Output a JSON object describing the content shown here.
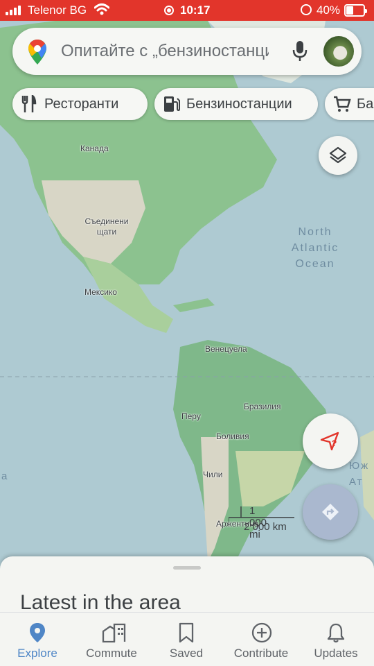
{
  "status_bar": {
    "carrier": "Telenor BG",
    "time": "10:17",
    "battery": "40%",
    "battery_level": 0.4
  },
  "search": {
    "placeholder": "Опитайте с „бензиностанции“"
  },
  "chips": [
    {
      "label": "Ресторанти",
      "icon": "restaurant-icon"
    },
    {
      "label": "Бензиностанции",
      "icon": "gas-station-icon"
    },
    {
      "label": "Ба",
      "icon": "shopping-cart-icon"
    }
  ],
  "map": {
    "labels": {
      "canada": "Канада",
      "usa": "Съединени щати",
      "mexico": "Мексико",
      "venezuela": "Венецуела",
      "brazil": "Бразилия",
      "peru": "Перу",
      "bolivia": "Боливия",
      "chile": "Чили",
      "argentina": "Аржентина"
    },
    "ocean": {
      "line1": "North",
      "line2": "Atlantic",
      "line3": "Ocean"
    },
    "edge": {
      "right1": "Юж",
      "right2": "Ат",
      "left": "a"
    },
    "scale": {
      "miles": "1 000 mi",
      "km": "2 000 km"
    }
  },
  "sheet": {
    "title": "Latest in the area"
  },
  "nav": [
    {
      "label": "Explore",
      "icon": "explore-pin-icon",
      "active": true
    },
    {
      "label": "Commute",
      "icon": "commute-icon",
      "active": false
    },
    {
      "label": "Saved",
      "icon": "bookmark-icon",
      "active": false
    },
    {
      "label": "Contribute",
      "icon": "add-circle-icon",
      "active": false
    },
    {
      "label": "Updates",
      "icon": "bell-icon",
      "active": false
    }
  ],
  "colors": {
    "status_bar": "#e2352b",
    "accent": "#4f86c6",
    "location_fab": "#e2352b"
  }
}
